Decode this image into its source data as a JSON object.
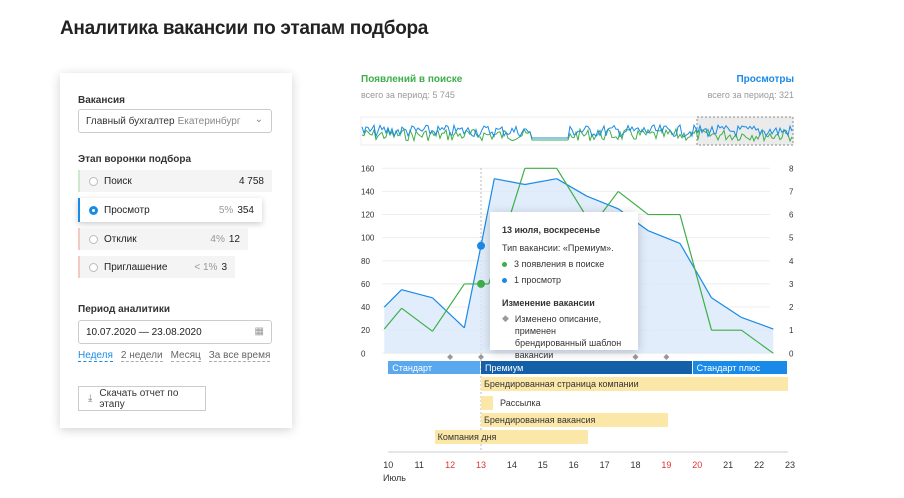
{
  "title": "Аналитика вакансии по этапам подбора",
  "sidebar": {
    "vacancy_label": "Вакансия",
    "vacancy_value": "Главный бухгалтер",
    "vacancy_city": "Екатеринбург",
    "stages_label": "Этап воронки подбора",
    "stages": [
      {
        "name": "Поиск",
        "pct": "",
        "count": "4 758",
        "color": "#cfe6cf"
      },
      {
        "name": "Просмотр",
        "pct": "5%",
        "count": "354",
        "color": "#1a8ae8"
      },
      {
        "name": "Отклик",
        "pct": "4%",
        "count": "12",
        "color": "#f3c9c4"
      },
      {
        "name": "Приглашение",
        "pct": "< 1%",
        "count": "3",
        "color": "#f3c9c4"
      }
    ],
    "period_label": "Период аналитики",
    "period_value": "10.07.2020 — 23.08.2020",
    "quick": [
      "Неделя",
      "2 недели",
      "Месяц",
      "За все время"
    ],
    "download": "Скачать отчет по этапу"
  },
  "legend": {
    "left_title": "Появлений в поиске",
    "left_sub": "всего за период: 5 745",
    "right_title": "Просмотры",
    "right_sub": "всего за период: 321"
  },
  "tooltip": {
    "date": "13 июля, воскресенье",
    "type": "Тип вакансии: «Премиум».",
    "green": "3 появления в поиске",
    "blue": "1 просмотр",
    "change_title": "Изменение вакансии",
    "change_text": "Изменено описание, применен брендированный шаблон вакансии"
  },
  "chart_data": {
    "type": "line",
    "left_ticks": [
      "0",
      "20",
      "40",
      "60",
      "80",
      "100",
      "120",
      "140",
      "160"
    ],
    "right_ticks": [
      "0",
      "1",
      "2",
      "3",
      "4",
      "5",
      "6",
      "7",
      "8"
    ],
    "ylim_left": [
      0,
      160
    ],
    "ylim_right": [
      0,
      8
    ],
    "series": [
      {
        "name": "Просмотры",
        "color": "#1a8ae8",
        "axis": "left",
        "x": [
          9.87,
          10.43,
          11.43,
          12.46,
          13.0,
          13.43,
          14.42,
          15.45,
          16.42,
          17.44,
          18.41,
          19.44,
          20.46,
          21.43,
          22.46
        ],
        "y": [
          40,
          55,
          48,
          22,
          93,
          151,
          146,
          151,
          136,
          125,
          106,
          95,
          48,
          31,
          21
        ]
      },
      {
        "name": "Появлений в поиске",
        "color": "#3fae49",
        "axis": "right",
        "x": [
          9.87,
          10.43,
          11.43,
          12.46,
          13.0,
          13.25,
          14.42,
          15.45,
          16.6,
          17.44,
          18.41,
          19.44,
          20.46,
          21.43,
          22.46
        ],
        "y": [
          1.05,
          1.95,
          0.95,
          3,
          3,
          3,
          8,
          8,
          5.5,
          7,
          6,
          6,
          1,
          1,
          0
        ]
      }
    ],
    "x_ticks": [
      {
        "d": 10,
        "red": false
      },
      {
        "d": 11,
        "red": false
      },
      {
        "d": 12,
        "red": true
      },
      {
        "d": 13,
        "red": true
      },
      {
        "d": 14,
        "red": false
      },
      {
        "d": 15,
        "red": false
      },
      {
        "d": 16,
        "red": false
      },
      {
        "d": 17,
        "red": false
      },
      {
        "d": 18,
        "red": false
      },
      {
        "d": 19,
        "red": true
      },
      {
        "d": 20,
        "red": true
      },
      {
        "d": 21,
        "red": false
      },
      {
        "d": 22,
        "red": false
      },
      {
        "d": 23,
        "red": false
      }
    ],
    "x_month": "Июль",
    "change_markers": [
      12,
      13,
      18,
      19
    ],
    "vacancy_types": [
      {
        "name": "Стандарт",
        "from": 10,
        "to": 13,
        "color": "#5aa8ee"
      },
      {
        "name": "Премиум",
        "from": 13,
        "to": 19.85,
        "color": "#1460a8"
      },
      {
        "name": "Стандарт плюс",
        "from": 19.85,
        "to": 22.95,
        "color": "#1a8ae8"
      }
    ],
    "services": [
      {
        "name": "Брендированная страница компании",
        "from": 13,
        "to": 22.95
      },
      {
        "name": "Рассылка",
        "from": 13,
        "to": 13.4
      },
      {
        "name": "Брендированная вакансия",
        "from": 13,
        "to": 19.05
      },
      {
        "name": "Компания дня",
        "from": 11.5,
        "to": 16.45
      }
    ]
  }
}
